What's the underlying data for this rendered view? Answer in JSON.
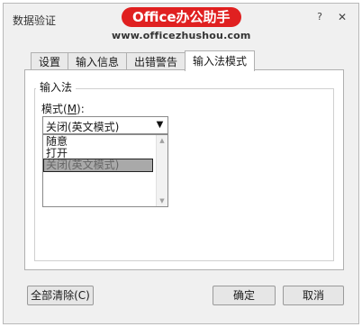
{
  "window": {
    "title": "数据验证",
    "help_glyph": "?",
    "close_glyph": "✕"
  },
  "watermark": {
    "logo_text": "Office办公助手",
    "url_text": "www.officezhushou.com"
  },
  "tabs": [
    {
      "label": "设置",
      "active": false
    },
    {
      "label": "输入信息",
      "active": false
    },
    {
      "label": "出错警告",
      "active": false
    },
    {
      "label": "输入法模式",
      "active": true
    }
  ],
  "ime_group": {
    "legend": "输入法",
    "mode_label_prefix": "模式(",
    "mode_label_key": "M",
    "mode_label_suffix": "):",
    "selected_value": "关闭(英文模式)",
    "options": [
      "随意",
      "打开",
      "关闭(英文模式)"
    ],
    "highlighted_index": 2
  },
  "buttons": {
    "clear_all": "全部清除(C)",
    "ok": "确定",
    "cancel": "取消"
  },
  "icons": {
    "dropdown_arrow": "chevron-down-icon",
    "scroll_up": "scroll-up-icon",
    "scroll_down": "scroll-down-icon"
  }
}
